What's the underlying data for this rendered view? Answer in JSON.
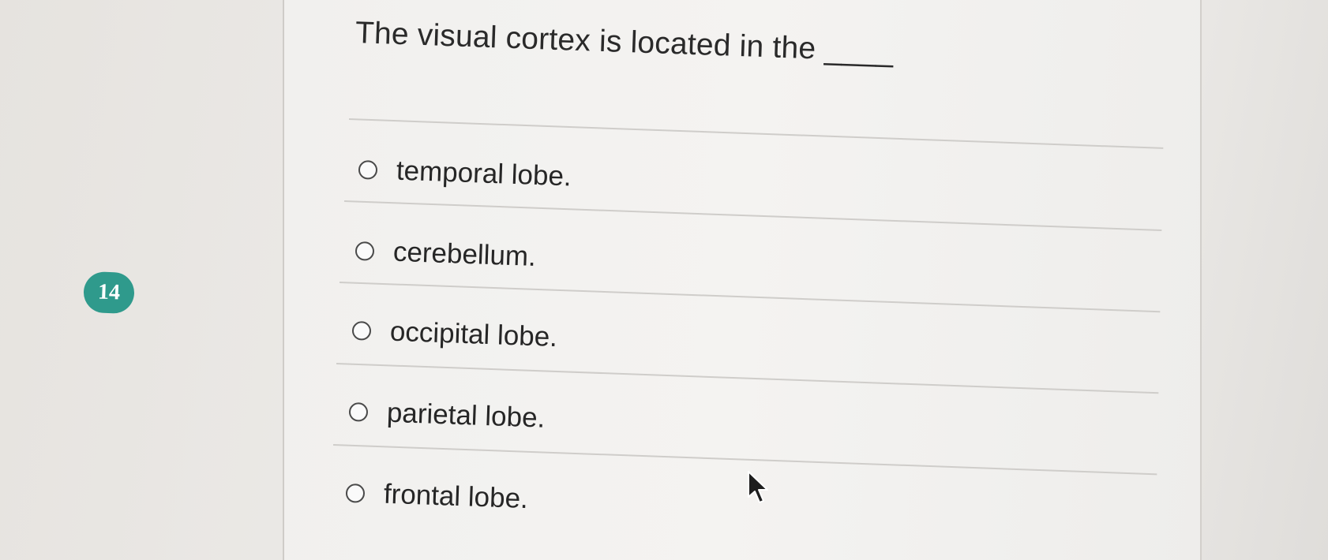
{
  "question": {
    "number": "14",
    "text": "The visual cortex is located in the ____"
  },
  "options": [
    {
      "label": "temporal lobe.",
      "selected": false
    },
    {
      "label": "cerebellum.",
      "selected": false
    },
    {
      "label": "occipital lobe.",
      "selected": false
    },
    {
      "label": "parietal lobe.",
      "selected": false
    },
    {
      "label": "frontal lobe.",
      "selected": false
    }
  ],
  "colors": {
    "badge": "#2f9a8c",
    "text": "#2a2a2a",
    "divider": "#cfcdca"
  },
  "icons": {
    "cursor": "mouse-pointer-icon",
    "radio": "radio-unchecked-icon"
  }
}
